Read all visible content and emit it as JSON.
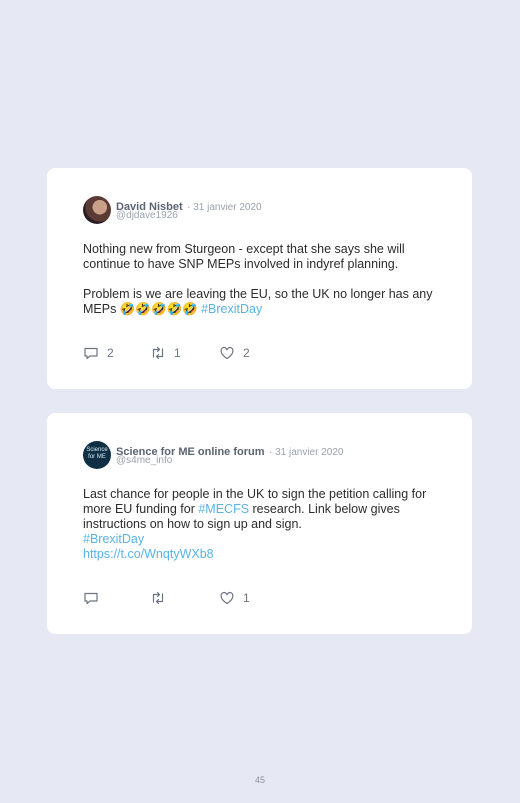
{
  "tweets": [
    {
      "name": "David Nisbet",
      "date": "· 31 janvier 2020",
      "handle": "@djdave1926",
      "para1": "Nothing new from Sturgeon - except that she says she will continue to have SNP MEPs involved in indyref planning.",
      "para2_text": "Problem is we are leaving the EU, so the UK no longer has any MEPs 🤣🤣🤣🤣🤣 ",
      "para2_link": "#BrexitDay",
      "reply_count": "2",
      "retweet_count": "1",
      "like_count": "2"
    },
    {
      "name": "Science for ME online forum",
      "date": "· 31 janvier 2020",
      "handle": "@s4me_info",
      "avatar_text": "Science for ME",
      "text_a": "Last chance for people in the UK to sign the petition calling for more EU funding for ",
      "link_a": "#MECFS",
      "text_b": " research. Link below gives instructions on how to sign up and sign.",
      "link_b": "#BrexitDay",
      "link_c": "https://t.co/WnqtyWXb8",
      "reply_count": "",
      "retweet_count": "",
      "like_count": "1"
    }
  ],
  "page_number": "45",
  "colors": {
    "background": "#e6e8f3",
    "card": "#ffffff",
    "link": "#58b3e6"
  }
}
